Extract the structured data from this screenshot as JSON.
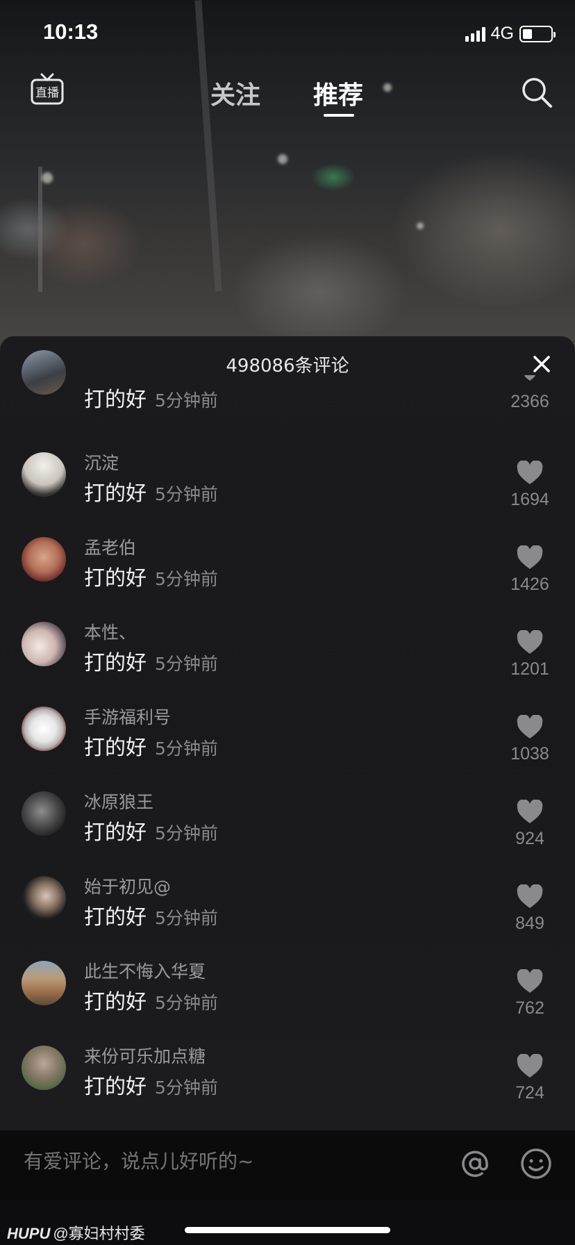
{
  "status_bar": {
    "time": "10:13",
    "network": "4G",
    "battery_level": 0.35,
    "signal_bars": 4
  },
  "nav": {
    "live_icon": "live-tv-icon",
    "live_label": "直播",
    "tabs": [
      {
        "label": "关注",
        "active": false
      },
      {
        "label": "推荐",
        "active": true
      }
    ],
    "search_icon": "search-icon"
  },
  "comments": {
    "title": "498086条评论",
    "close_icon": "close-icon",
    "items": [
      {
        "user": "",
        "text": "打的好",
        "time": "5分钟前",
        "likes": "2366"
      },
      {
        "user": "沉淀",
        "text": "打的好",
        "time": "5分钟前",
        "likes": "1694"
      },
      {
        "user": "孟老伯",
        "text": "打的好",
        "time": "5分钟前",
        "likes": "1426"
      },
      {
        "user": "本性、",
        "text": "打的好",
        "time": "5分钟前",
        "likes": "1201"
      },
      {
        "user": "手游福利号",
        "text": "打的好",
        "time": "5分钟前",
        "likes": "1038"
      },
      {
        "user": "冰原狼王",
        "text": "打的好",
        "time": "5分钟前",
        "likes": "924"
      },
      {
        "user": "始于初见@",
        "text": "打的好",
        "time": "5分钟前",
        "likes": "849"
      },
      {
        "user": "此生不悔入华夏",
        "text": "打的好",
        "time": "5分钟前",
        "likes": "762"
      },
      {
        "user": "来份可乐加点糖",
        "text": "打的好",
        "time": "5分钟前",
        "likes": "724"
      }
    ]
  },
  "input": {
    "placeholder": "有爱评论，说点儿好听的~",
    "at_icon": "at-icon",
    "emoji_icon": "emoji-icon"
  },
  "footer": {
    "brand": "HUPU",
    "handle": "@寡妇村村委"
  },
  "colors": {
    "sheet_bg": "#1b1b1d",
    "muted_text": "#8a8a8c",
    "heart": "#8a8a8c"
  }
}
